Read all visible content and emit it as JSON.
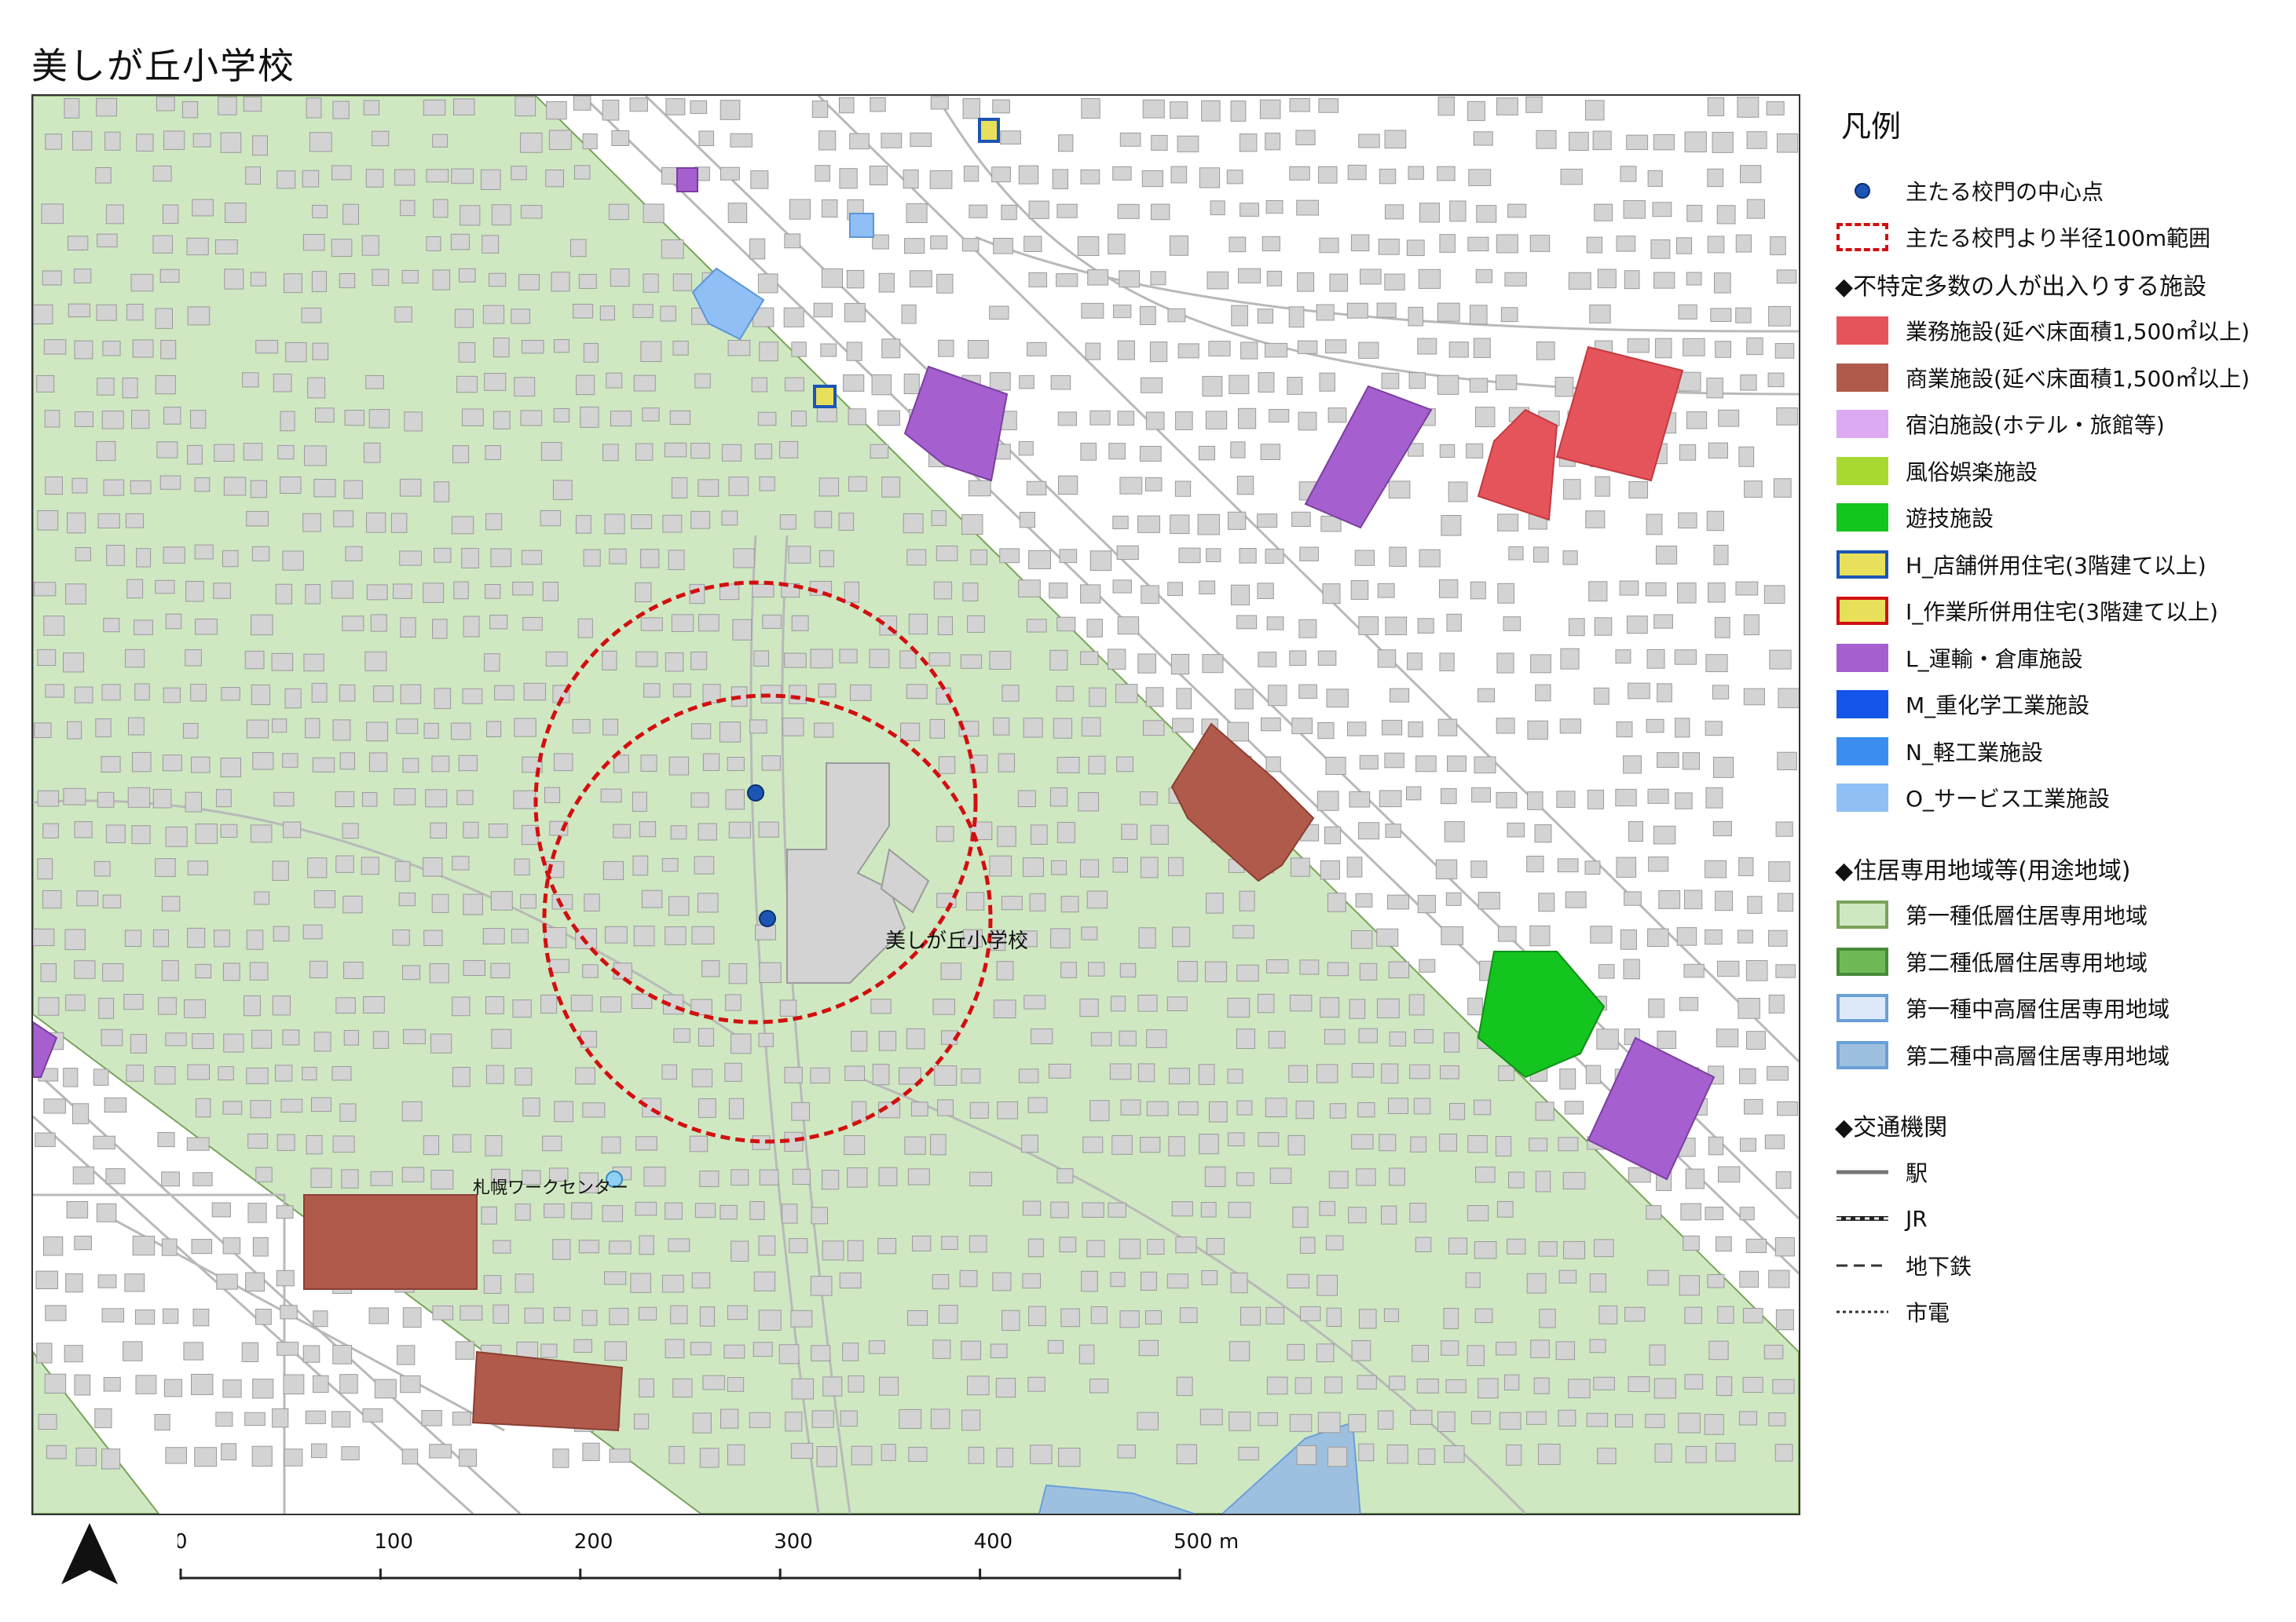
{
  "title": "美しが丘小学校",
  "colors": {
    "zone1_low": "#cfe8c2",
    "zone_border": "#7aa35a",
    "building": "#d3d3d3",
    "building_stroke": "#9a9a9a",
    "business": "#e5545a",
    "commercial": "#b05a4b",
    "transport": "#a55fcf",
    "light_industry": "#8fbff5",
    "amusement": "#14c41f",
    "circle": "#d20f0f",
    "gate": "#1c55b4",
    "zone2_high": "#9ec0e0",
    "shop_house": "#e8e05a"
  },
  "map": {
    "school_label": "美しが丘小学校",
    "work_center_label": "札幌ワークセンター"
  },
  "legend": {
    "title": "凡例",
    "gate_center": "主たる校門の中心点",
    "radius_range": "主たる校門より半径100m範囲",
    "facilities_header": "◆不特定多数の人が出入りする施設",
    "facilities": [
      {
        "label": "業務施設(延べ床面積1,500㎡以上)",
        "fill": "#e5545a",
        "stroke": "#e5545a"
      },
      {
        "label": "商業施設(延べ床面積1,500㎡以上)",
        "fill": "#b05a4b",
        "stroke": "#b05a4b"
      },
      {
        "label": "宿泊施設(ホテル・旅館等)",
        "fill": "#dcaaf2",
        "stroke": "#dcaaf2"
      },
      {
        "label": "風俗娯楽施設",
        "fill": "#a8d832",
        "stroke": "#a8d832"
      },
      {
        "label": "遊技施設",
        "fill": "#14c41f",
        "stroke": "#14c41f"
      },
      {
        "label": "H_店舗併用住宅(3階建て以上)",
        "fill": "#e8e05a",
        "stroke": "#1c55b4"
      },
      {
        "label": "I_作業所併用住宅(3階建て以上)",
        "fill": "#e8e05a",
        "stroke": "#d20f0f"
      },
      {
        "label": "L_運輸・倉庫施設",
        "fill": "#a55fcf",
        "stroke": "#a55fcf"
      },
      {
        "label": "M_重化学工業施設",
        "fill": "#1454e8",
        "stroke": "#1454e8"
      },
      {
        "label": "N_軽工業施設",
        "fill": "#3b8ef0",
        "stroke": "#3b8ef0"
      },
      {
        "label": "O_サービス工業施設",
        "fill": "#8fbff5",
        "stroke": "#8fbff5"
      }
    ],
    "zones_header": "◆住居専用地域等(用途地域)",
    "zones": [
      {
        "label": "第一種低層住居専用地域",
        "fill": "#cfe8c2",
        "stroke": "#7aa35a"
      },
      {
        "label": "第二種低層住居専用地域",
        "fill": "#6fba57",
        "stroke": "#4a8a3a"
      },
      {
        "label": "第一種中高層住居専用地域",
        "fill": "#dde9f8",
        "stroke": "#6a9fd8"
      },
      {
        "label": "第二種中高層住居専用地域",
        "fill": "#9ec0e0",
        "stroke": "#6a9fd8"
      }
    ],
    "transport_header": "◆交通機関",
    "transport": [
      {
        "label": "駅",
        "style": "solid"
      },
      {
        "label": "JR",
        "style": "rail"
      },
      {
        "label": "地下鉄",
        "style": "dashed"
      },
      {
        "label": "市電",
        "style": "dotted"
      }
    ]
  },
  "scale": {
    "ticks": [
      "0",
      "100",
      "200",
      "300",
      "400",
      "500 m"
    ],
    "tick_values": [
      0,
      100,
      200,
      300,
      400,
      500
    ]
  }
}
